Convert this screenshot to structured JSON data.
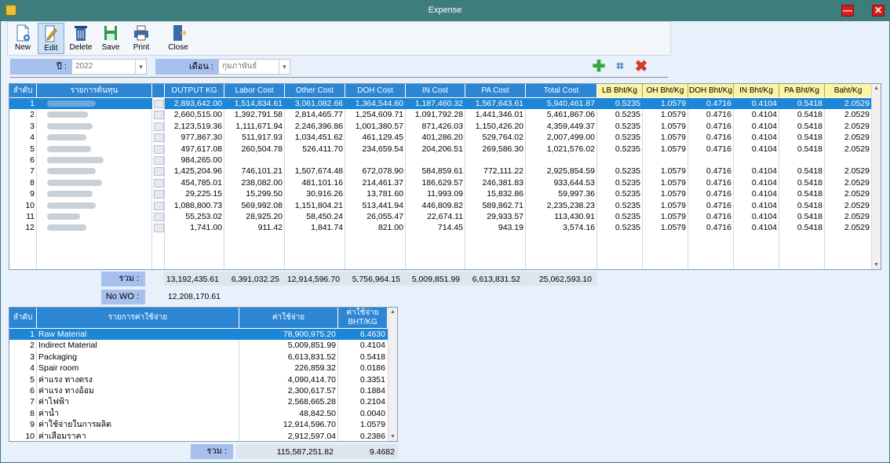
{
  "window": {
    "title": "Expense",
    "minimize_label": "—",
    "close_label": "✕"
  },
  "toolbar": [
    {
      "label": "New",
      "icon": "new-document-icon"
    },
    {
      "label": "Edit",
      "icon": "edit-icon"
    },
    {
      "label": "Delete",
      "icon": "trash-icon"
    },
    {
      "label": "Save",
      "icon": "save-icon"
    },
    {
      "label": "Print",
      "icon": "printer-icon"
    },
    {
      "label": "Close",
      "icon": "exit-door-icon"
    }
  ],
  "filters": {
    "year_label": "ปี :",
    "year_value": "2022",
    "month_label": "เดือน :",
    "month_value": "กุมภาพันธ์"
  },
  "cost_table": {
    "headers": [
      "ลำดับ",
      "รายการต้นทุน",
      "",
      "OUTPUT KG",
      "Labor Cost",
      "Other Cost",
      "DOH Cost",
      "IN Cost",
      "PA Cost",
      "Total Cost",
      "LB Bht/Kg",
      "OH Bht/Kg",
      "DOH Bht/Kg",
      "IN Bht/Kg",
      "PA Bht/Kg",
      "Baht/Kg"
    ],
    "rows": [
      [
        "1",
        "",
        "2,893,642.00",
        "1,514,834.61",
        "3,061,082.66",
        "1,364,544.60",
        "1,187,460.32",
        "1,567,643.61",
        "5,940,461.87",
        "0.5235",
        "1.0579",
        "0.4716",
        "0.4104",
        "0.5418",
        "2.0529"
      ],
      [
        "2",
        "",
        "2,660,515.00",
        "1,392,791.58",
        "2,814,465.77",
        "1,254,609.71",
        "1,091,792.28",
        "1,441,346.01",
        "5,461,867.06",
        "0.5235",
        "1.0579",
        "0.4716",
        "0.4104",
        "0.5418",
        "2.0529"
      ],
      [
        "3",
        "",
        "2,123,519.36",
        "1,111,671.94",
        "2,246,396.86",
        "1,001,380.57",
        "871,426.03",
        "1,150,426.20",
        "4,359,449.37",
        "0.5235",
        "1.0579",
        "0.4716",
        "0.4104",
        "0.5418",
        "2.0529"
      ],
      [
        "4",
        "",
        "977,867.30",
        "511,917.93",
        "1,034,451.62",
        "461,129.45",
        "401,286.20",
        "529,764.02",
        "2,007,499.00",
        "0.5235",
        "1.0579",
        "0.4716",
        "0.4104",
        "0.5418",
        "2.0529"
      ],
      [
        "5",
        "",
        "497,617.08",
        "260,504.78",
        "526,411.70",
        "234,659.54",
        "204,206.51",
        "269,586.30",
        "1,021,576.02",
        "0.5235",
        "1.0579",
        "0.4716",
        "0.4104",
        "0.5418",
        "2.0529"
      ],
      [
        "6",
        "",
        "984,265.00",
        "",
        "",
        "",
        "",
        "",
        "",
        "",
        "",
        "",
        "",
        "",
        ""
      ],
      [
        "7",
        "",
        "1,425,204.96",
        "746,101.21",
        "1,507,674.48",
        "672,078.90",
        "584,859.61",
        "772,111.22",
        "2,925,854.59",
        "0.5235",
        "1.0579",
        "0.4716",
        "0.4104",
        "0.5418",
        "2.0529"
      ],
      [
        "8",
        "",
        "454,785.01",
        "238,082.00",
        "481,101.16",
        "214,461.37",
        "186,629.57",
        "246,381.83",
        "933,644.53",
        "0.5235",
        "1.0579",
        "0.4716",
        "0.4104",
        "0.5418",
        "2.0529"
      ],
      [
        "9",
        "",
        "29,225.15",
        "15,299.50",
        "30,916.26",
        "13,781.60",
        "11,993.09",
        "15,832.86",
        "59,997.36",
        "0.5235",
        "1.0579",
        "0.4716",
        "0.4104",
        "0.5418",
        "2.0529"
      ],
      [
        "10",
        "",
        "1,088,800.73",
        "569,992.08",
        "1,151,804.21",
        "513,441.94",
        "446,809.82",
        "589,862.71",
        "2,235,238.23",
        "0.5235",
        "1.0579",
        "0.4716",
        "0.4104",
        "0.5418",
        "2.0529"
      ],
      [
        "11",
        "",
        "55,253.02",
        "28,925.20",
        "58,450.24",
        "26,055.47",
        "22,674.11",
        "29,933.57",
        "113,430.91",
        "0.5235",
        "1.0579",
        "0.4716",
        "0.4104",
        "0.5418",
        "2.0529"
      ],
      [
        "12",
        "",
        "1,741.00",
        "911.42",
        "1,841.74",
        "821.00",
        "714.45",
        "943.19",
        "3,574.16",
        "0.5235",
        "1.0579",
        "0.4716",
        "0.4104",
        "0.5418",
        "2.0529"
      ]
    ],
    "sum_label": "รวม :",
    "sums": [
      "13,192,435.61",
      "6,391,032.25",
      "12,914,596.70",
      "5,756,964.15",
      "5,009,851.99",
      "6,613,831.52",
      "25,062,593.10"
    ],
    "nowo_label": "No WO :",
    "nowo_value": "12,208,170.61"
  },
  "expense_table": {
    "headers": [
      "ลำดับ",
      "รายการค่าใช้จ่าย",
      "ค่าใช้จ่าย",
      "ค่าใช้จ่าย",
      "BHT/KG"
    ],
    "rows": [
      [
        "1",
        "Raw Material",
        "78,900,975.20",
        "6.4630"
      ],
      [
        "2",
        "Indirect Material",
        "5,009,851.99",
        "0.4104"
      ],
      [
        "3",
        "Packaging",
        "6,613,831.52",
        "0.5418"
      ],
      [
        "4",
        "Spair room",
        "226,859.32",
        "0.0186"
      ],
      [
        "5",
        "ค่าแรง ทางตรง",
        "4,090,414.70",
        "0.3351"
      ],
      [
        "6",
        "ค่าแรง ทางอ้อม",
        "2,300,617.57",
        "0.1884"
      ],
      [
        "7",
        "ค่าไฟฟ้า",
        "2,568,665.28",
        "0.2104"
      ],
      [
        "8",
        "ค่าน้ำ",
        "48,842.50",
        "0.0040"
      ],
      [
        "9",
        "ค่าใช้จ่ายในการผลิต",
        "12,914,596.70",
        "1.0579"
      ],
      [
        "10",
        "ค่าเสื่อมราคา",
        "2,912,597.04",
        "0.2386"
      ]
    ],
    "sum_label": "รวม :",
    "sum_total": "115,587,251.82",
    "sum_bht": "9.4682"
  },
  "colors": {
    "header_blue": "#2d86d4",
    "selected_row": "#1e86d6",
    "yellow_header": "#fbf4a6",
    "label_blue": "#a8c0ee",
    "titlebar": "#3e7d7e"
  }
}
